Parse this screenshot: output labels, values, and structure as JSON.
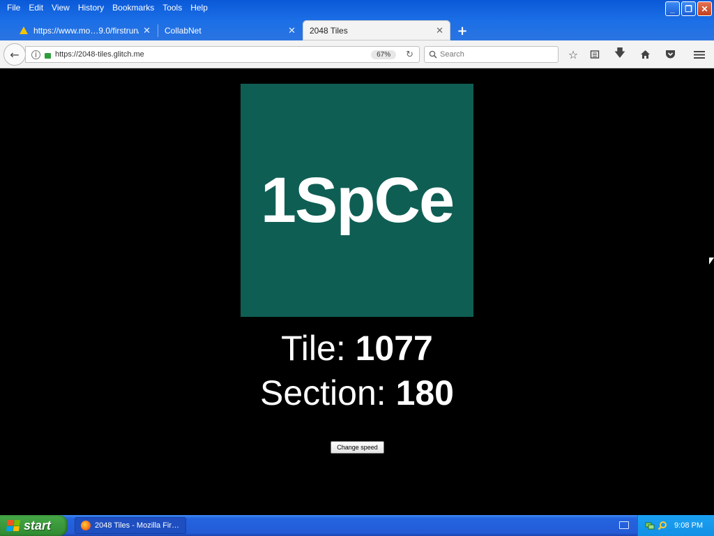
{
  "menubar": {
    "items": [
      "File",
      "Edit",
      "View",
      "History",
      "Bookmarks",
      "Tools",
      "Help"
    ]
  },
  "window_controls": {
    "minimize": "_",
    "restore": "❐",
    "close": "✕"
  },
  "tabs": [
    {
      "label": "https://www.mo…9.0/firstrun/",
      "close": "✕"
    },
    {
      "label": "CollabNet",
      "close": "✕"
    },
    {
      "label": "2048 Tiles",
      "close": "✕"
    }
  ],
  "new_tab_label": "+",
  "navbar": {
    "url": "https://2048-tiles.glitch.me",
    "zoom": "67%",
    "search_placeholder": "Search"
  },
  "page": {
    "tile_text": "1SpCe",
    "tile_color": "#0f5e54",
    "tile_line_label": "Tile: ",
    "tile_value": "1077",
    "section_line_label": "Section: ",
    "section_value": "180",
    "change_speed_label": "Change speed"
  },
  "taskbar": {
    "start_label": "start",
    "task_item": "2048 Tiles - Mozilla Fir…",
    "clock": "9:08 PM"
  },
  "colors": {
    "titlebar_blue": "#1c6fe6",
    "page_background": "#000000",
    "taskbar_blue": "#245bd6",
    "start_green": "#3c9a3d"
  }
}
